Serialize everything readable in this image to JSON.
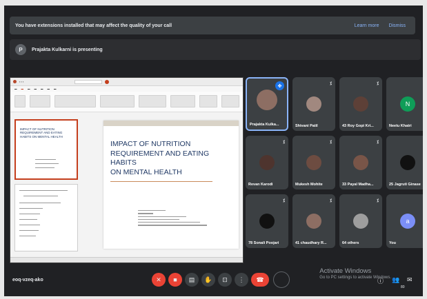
{
  "banner": {
    "text": "You have extensions installed that may affect the quality of your call",
    "learn_more": "Learn more",
    "dismiss": "Dismiss"
  },
  "presenting": {
    "avatar_letter": "P",
    "text": "Prajakta Kulkarni is presenting"
  },
  "shared_screen": {
    "thumb_title": "IMPACT OF NUTRITION REQUIREMENT AND EATING HABITS ON MENTAL HEALTH",
    "slide_title_line1": "IMPACT OF NUTRITION",
    "slide_title_line2": "REQUIREMENT AND EATING HABITS",
    "slide_title_line3": "ON MENTAL HEALTH"
  },
  "participants": [
    {
      "name": "Prajakta Kulka...",
      "active": true
    },
    {
      "name": "Shivani Patil"
    },
    {
      "name": "43 Roy Gopi Kri..."
    },
    {
      "name": "Neetu Khatri",
      "initial": "N"
    },
    {
      "name": "Revan Karodi"
    },
    {
      "name": "Mukesh Mohite"
    },
    {
      "name": "33 Payal Madha..."
    },
    {
      "name": "25 Jagruti Ginase"
    },
    {
      "name": "78 Sonali Poojari"
    },
    {
      "name": "41 chaudhary R..."
    },
    {
      "name": "64 others"
    },
    {
      "name": "You",
      "initial": "a"
    }
  ],
  "bottom": {
    "meeting_code": "eoq-vzeq-ako",
    "activate_title": "Activate Windows",
    "activate_sub": "Go to PC settings to activate Windows.",
    "people_count": "80"
  },
  "colors": {
    "background": "#202124",
    "tile": "#3c4043",
    "red": "#ea4335",
    "blue": "#1a73e8",
    "slide_title": "#1f3864"
  }
}
